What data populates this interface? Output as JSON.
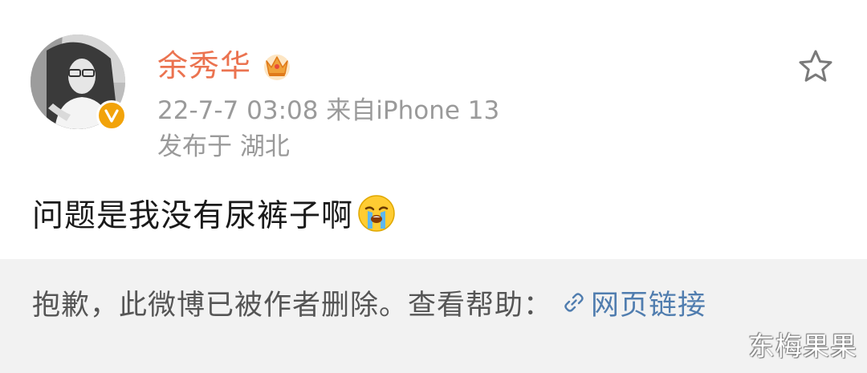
{
  "post": {
    "author": {
      "name": "余秀华",
      "verified_color": "#f2a30a",
      "name_color": "#eb7350"
    },
    "time_source": "22-7-7 03:08  来自iPhone 13",
    "location": "发布于 湖北",
    "content": "问题是我没有尿裤子啊",
    "emoji": "crying-face-icon"
  },
  "deleted_notice": {
    "text": "抱歉，此微博已被作者删除。查看帮助：",
    "link_label": "网页链接",
    "link_color": "#507daf"
  },
  "watermark": "东梅果果",
  "icons": {
    "favorite": "star-icon",
    "membership": "crown-icon",
    "verified": "verified-v-icon",
    "link": "link-icon"
  }
}
